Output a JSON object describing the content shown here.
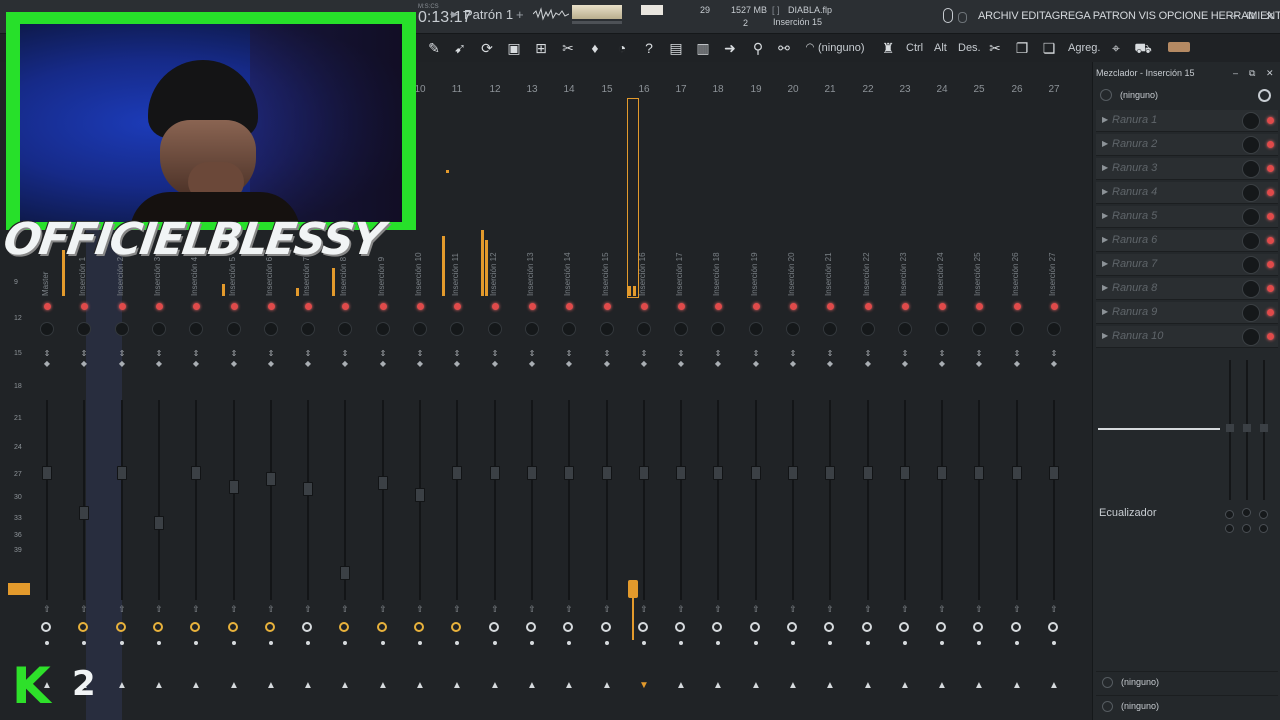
{
  "topbar": {
    "time_meta": "M:S:CS",
    "time_value": "0:13:17",
    "pattern_name": "Patrón 1",
    "pattern_add": "+",
    "cpu": "29",
    "memory": "1527 MB",
    "polyphony": "2",
    "file_name": "DIABLA.flp",
    "file_bracket": "[ ]",
    "current_insert": "Inserción 15",
    "menu": "ARCHIV EDITAGREGA PATRON VIS OPCIONE HERRAMIENTA",
    "win_min": "–",
    "win_max": "⧉",
    "win_close": "✕"
  },
  "toolbar": {
    "none_label": "(ninguno)",
    "ctrl": "Ctrl",
    "alt": "Alt",
    "des": "Des.",
    "agreg": "Agreg."
  },
  "mixer": {
    "strips": [
      {
        "num": "",
        "label": "Master",
        "fader": 0.67,
        "send_active": false
      },
      {
        "num": "",
        "label": "Inserción 1",
        "fader": 0.47,
        "send_active": true
      },
      {
        "num": "",
        "label": "Inserción 2",
        "fader": 0.67,
        "send_active": true
      },
      {
        "num": "",
        "label": "Inserción 3",
        "fader": 0.42,
        "send_active": true
      },
      {
        "num": "",
        "label": "Inserción 4",
        "fader": 0.67,
        "send_active": true
      },
      {
        "num": "",
        "label": "Inserción 5",
        "fader": 0.6,
        "send_active": true
      },
      {
        "num": "",
        "label": "Inserción 6",
        "fader": 0.64,
        "send_active": true
      },
      {
        "num": "",
        "label": "Inserción 7",
        "fader": 0.59,
        "send_active": false
      },
      {
        "num": "",
        "label": "Inserción 8",
        "fader": 0.17,
        "send_active": true
      },
      {
        "num": "",
        "label": "Inserción 9",
        "fader": 0.62,
        "send_active": true
      },
      {
        "num": "10",
        "label": "Inserción 10",
        "fader": 0.56,
        "send_active": true
      },
      {
        "num": "11",
        "label": "Inserción 11",
        "fader": 0.67,
        "send_active": true
      },
      {
        "num": "12",
        "label": "Inserción 12",
        "fader": 0.67,
        "send_active": false
      },
      {
        "num": "13",
        "label": "Inserción 13",
        "fader": 0.67,
        "send_active": false
      },
      {
        "num": "14",
        "label": "Inserción 14",
        "fader": 0.67,
        "send_active": false
      },
      {
        "num": "15",
        "label": "Inserción 15",
        "fader": 0.67,
        "send_active": false
      },
      {
        "num": "16",
        "label": "Inserción 16",
        "fader": 0.67,
        "send_active": false
      },
      {
        "num": "17",
        "label": "Inserción 17",
        "fader": 0.67,
        "send_active": false
      },
      {
        "num": "18",
        "label": "Inserción 18",
        "fader": 0.67,
        "send_active": false
      },
      {
        "num": "19",
        "label": "Inserción 19",
        "fader": 0.67,
        "send_active": false
      },
      {
        "num": "20",
        "label": "Inserción 20",
        "fader": 0.67,
        "send_active": false
      },
      {
        "num": "21",
        "label": "Inserción 21",
        "fader": 0.67,
        "send_active": false
      },
      {
        "num": "22",
        "label": "Inserción 22",
        "fader": 0.67,
        "send_active": false
      },
      {
        "num": "23",
        "label": "Inserción 23",
        "fader": 0.67,
        "send_active": false
      },
      {
        "num": "24",
        "label": "Inserción 24",
        "fader": 0.67,
        "send_active": false
      },
      {
        "num": "25",
        "label": "Inserción 25",
        "fader": 0.67,
        "send_active": false
      },
      {
        "num": "26",
        "label": "Inserción 26",
        "fader": 0.67,
        "send_active": false
      },
      {
        "num": "27",
        "label": "Inserción 27",
        "fader": 0.67,
        "send_active": false
      }
    ],
    "scale": [
      "9",
      "12",
      "15",
      "18",
      "21",
      "24",
      "27",
      "30",
      "33",
      "36",
      "39"
    ]
  },
  "panel": {
    "title": "Mezclador - Inserción 15",
    "input": "(ninguno)",
    "slots": [
      "Ranura 1",
      "Ranura 2",
      "Ranura 3",
      "Ranura 4",
      "Ranura 5",
      "Ranura 6",
      "Ranura 7",
      "Ranura 8",
      "Ranura 9",
      "Ranura 10"
    ],
    "eq_label": "Ecualizador",
    "output_1": "(ninguno)",
    "output_2": "(ninguno)"
  },
  "overlay": {
    "streamer_name": "OFFICIELBLESSY",
    "logo_letter": "K",
    "logo_number": "2"
  },
  "colors": {
    "accent": "#e39a2c",
    "green": "#27e02a",
    "record_red": "#e04a4a"
  }
}
